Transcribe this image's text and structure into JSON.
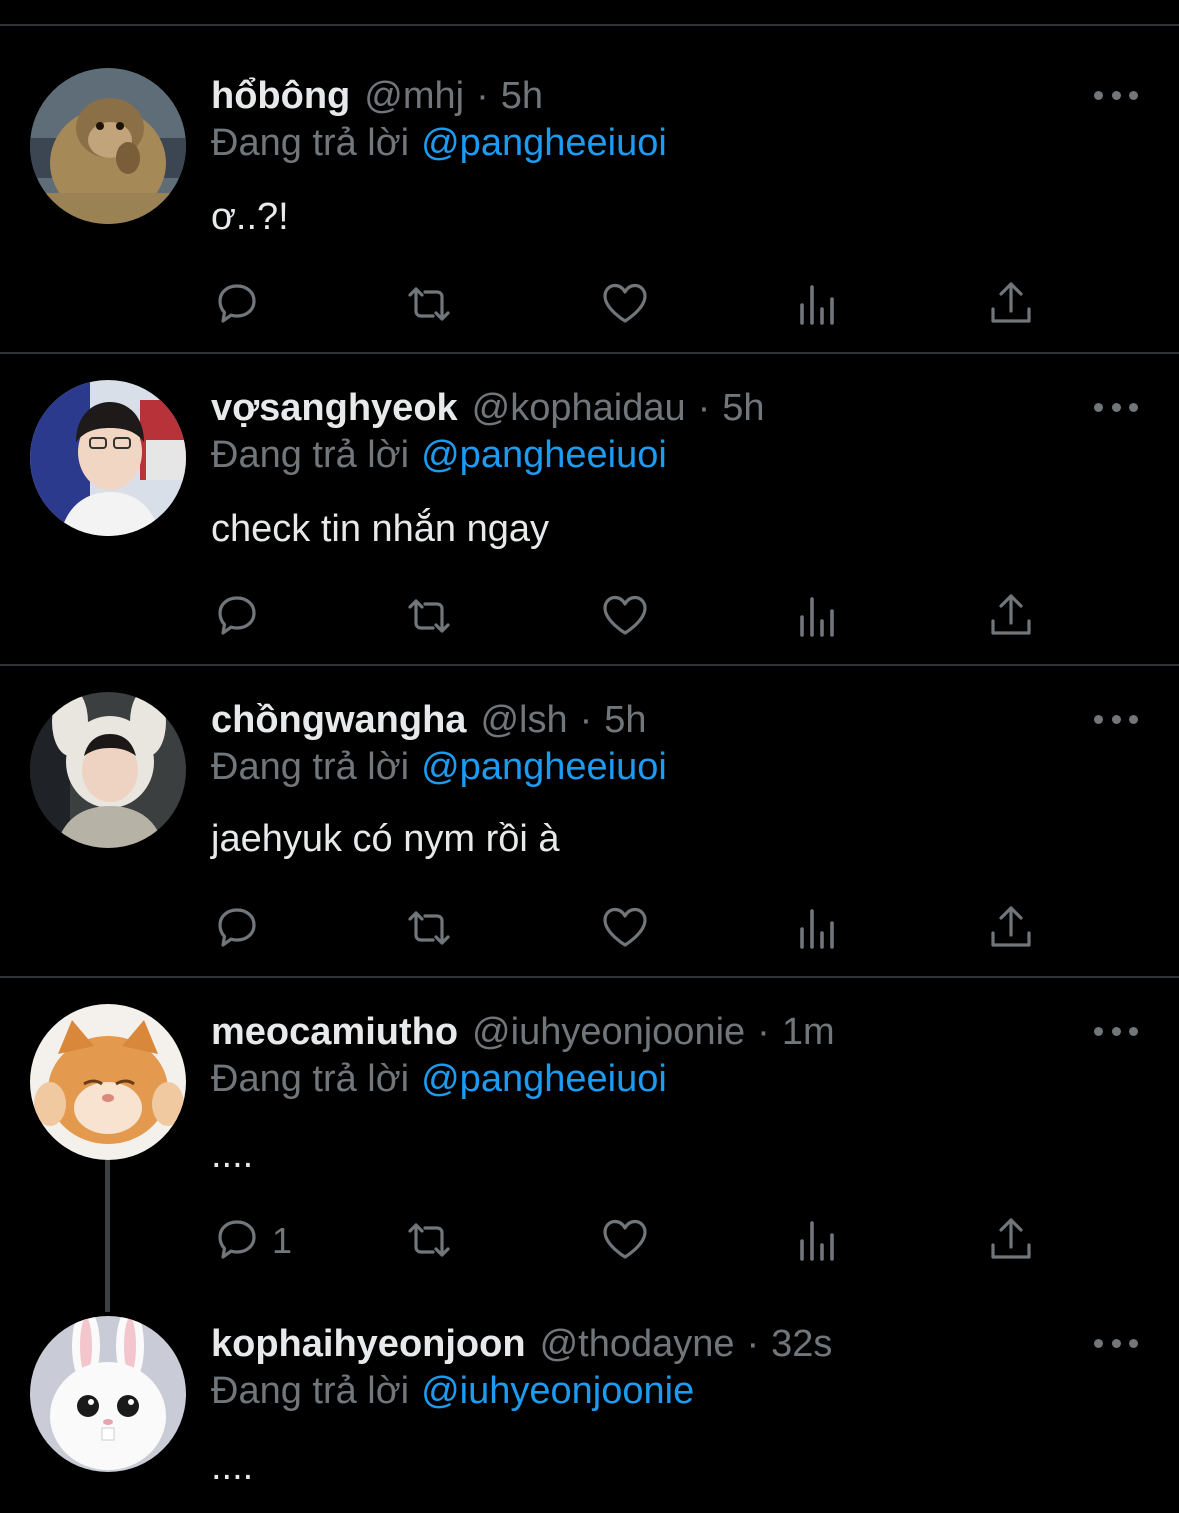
{
  "reply_prefix": "Đang trả lời",
  "tweets": [
    {
      "name": "hổbông",
      "handle": "@mhj",
      "time": "5h",
      "reply_to": "@pangheeiuoi",
      "text": "ơ..?!",
      "avatar": "monkey-avatar",
      "reply_count": ""
    },
    {
      "name": "vợsanghyeok",
      "handle": "@kophaidau",
      "time": "5h",
      "reply_to": "@pangheeiuoi",
      "text": "check tin nhắn ngay",
      "avatar": "person-avatar",
      "reply_count": ""
    },
    {
      "name": "chồngwangha",
      "handle": "@lsh",
      "time": "5h",
      "reply_to": "@pangheeiuoi",
      "text": "jaehyuk có nym rồi à",
      "avatar": "person-bunny-hat-avatar",
      "reply_count": ""
    },
    {
      "name": "meocamiutho",
      "handle": "@iuhyeonjoonie",
      "time": "1m",
      "reply_to": "@pangheeiuoi",
      "text": "....",
      "avatar": "orange-cat-avatar",
      "reply_count": "1"
    },
    {
      "name": "kophaihyeonjoon",
      "handle": "@thodayne",
      "time": "32s",
      "reply_to": "@iuhyeonjoonie",
      "text": "....",
      "avatar": "white-rabbit-avatar",
      "reply_count": ""
    }
  ],
  "icons": {
    "reply": "reply-icon",
    "retweet": "retweet-icon",
    "like": "heart-icon",
    "views": "views-icon",
    "share": "share-icon",
    "more": "more-icon"
  },
  "colors": {
    "background": "#000000",
    "text": "#e7e9ea",
    "muted": "#71767b",
    "mention": "#1d9bf0",
    "divider": "#2f3336"
  }
}
